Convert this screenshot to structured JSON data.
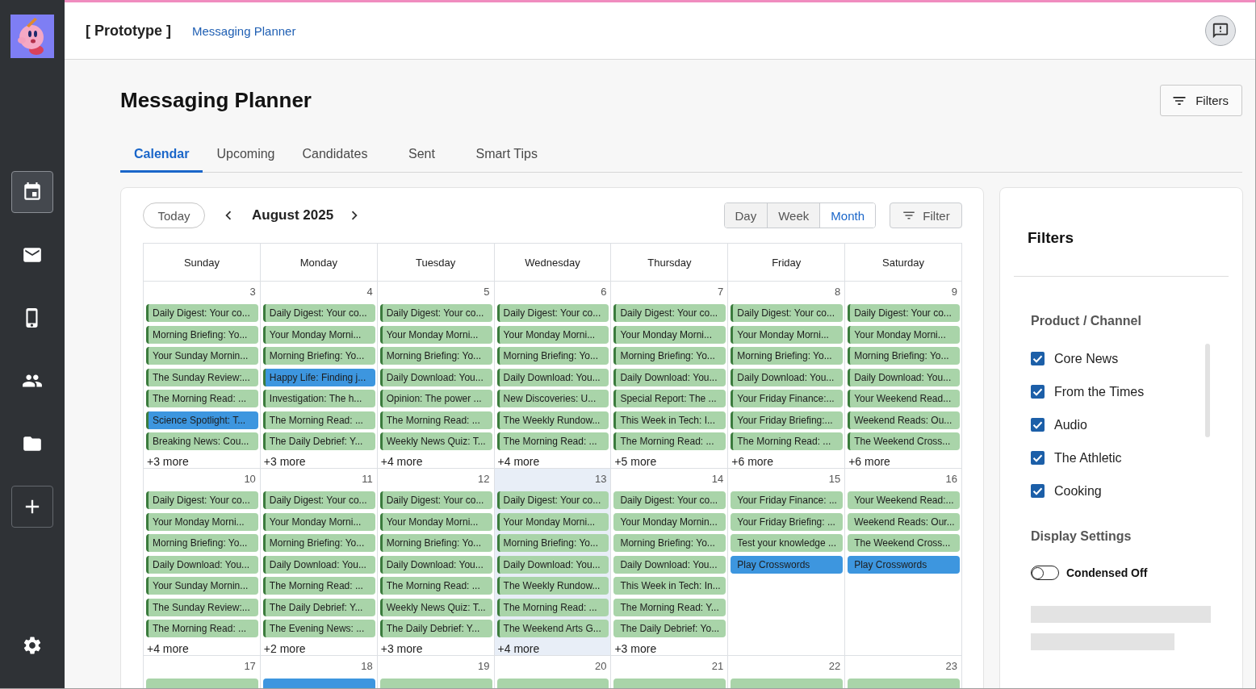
{
  "sidebar": {
    "nav": [
      {
        "selected": true
      },
      {
        "selected": false
      },
      {
        "selected": false
      },
      {
        "selected": false
      },
      {
        "selected": false
      }
    ]
  },
  "header": {
    "brand": "[ Prototype ]",
    "breadcrumb": "Messaging Planner"
  },
  "page": {
    "title": "Messaging Planner",
    "filters_button": "Filters"
  },
  "tabs": [
    {
      "label": "Calendar",
      "selected": true
    },
    {
      "label": "Upcoming",
      "selected": false
    },
    {
      "label": "Candidates",
      "selected": false
    },
    {
      "label": "Sent",
      "selected": false
    },
    {
      "label": "Smart Tips",
      "selected": false
    }
  ],
  "calendar": {
    "today_button": "Today",
    "month": "August 2025",
    "views": [
      {
        "label": "Day",
        "selected": false
      },
      {
        "label": "Week",
        "selected": false
      },
      {
        "label": "Month",
        "selected": true
      }
    ],
    "filter_button": "Filter",
    "weekdays": [
      "Sunday",
      "Monday",
      "Tuesday",
      "Wednesday",
      "Thursday",
      "Friday",
      "Saturday"
    ],
    "weeks": [
      {
        "days": [
          {
            "date": "3",
            "today": false,
            "sent": true,
            "events": [
              {
                "title": "Daily Digest: Your co...",
                "color": "#a9d4a9"
              },
              {
                "title": "Morning Briefing: Yo...",
                "color": "#a9d4a9"
              },
              {
                "title": "Your Sunday Mornin...",
                "color": "#a9d4a9"
              },
              {
                "title": "The Sunday Review:...",
                "color": "#a9d4a9"
              },
              {
                "title": "The Morning Read: ...",
                "color": "#a9d4a9"
              },
              {
                "title": "Science Spotlight: T...",
                "color": "#3d96df"
              },
              {
                "title": "Breaking News: Cou...",
                "color": "#a9d4a9"
              }
            ],
            "more": "+3 more"
          },
          {
            "date": "4",
            "today": false,
            "sent": true,
            "events": [
              {
                "title": "Daily Digest: Your co...",
                "color": "#a9d4a9"
              },
              {
                "title": "Your Monday Morni...",
                "color": "#a9d4a9"
              },
              {
                "title": "Morning Briefing: Yo...",
                "color": "#a9d4a9"
              },
              {
                "title": "Happy Life: Finding j...",
                "color": "#3d96df"
              },
              {
                "title": "Investigation: The h...",
                "color": "#a9d4a9"
              },
              {
                "title": "The Morning Read: ...",
                "color": "#a9d4a9"
              },
              {
                "title": "The Daily Debrief: Y...",
                "color": "#a9d4a9"
              }
            ],
            "more": "+3 more"
          },
          {
            "date": "5",
            "today": false,
            "sent": true,
            "events": [
              {
                "title": "Daily Digest: Your co...",
                "color": "#a9d4a9"
              },
              {
                "title": "Your Monday Morni...",
                "color": "#a9d4a9"
              },
              {
                "title": "Morning Briefing: Yo...",
                "color": "#a9d4a9"
              },
              {
                "title": "Daily Download: You...",
                "color": "#a9d4a9"
              },
              {
                "title": "Opinion: The power ...",
                "color": "#a9d4a9"
              },
              {
                "title": "The Morning Read: ...",
                "color": "#a9d4a9"
              },
              {
                "title": "Weekly News Quiz: T...",
                "color": "#a9d4a9"
              }
            ],
            "more": "+4 more"
          },
          {
            "date": "6",
            "today": false,
            "sent": true,
            "events": [
              {
                "title": "Daily Digest: Your co...",
                "color": "#a9d4a9"
              },
              {
                "title": "Your Monday Morni...",
                "color": "#a9d4a9"
              },
              {
                "title": "Morning Briefing: Yo...",
                "color": "#a9d4a9"
              },
              {
                "title": "Daily Download: You...",
                "color": "#a9d4a9"
              },
              {
                "title": "New Discoveries: U...",
                "color": "#a9d4a9"
              },
              {
                "title": "The Weekly Rundow...",
                "color": "#a9d4a9"
              },
              {
                "title": "The Morning Read: ...",
                "color": "#a9d4a9"
              }
            ],
            "more": "+4 more"
          },
          {
            "date": "7",
            "today": false,
            "sent": true,
            "events": [
              {
                "title": "Daily Digest: Your co...",
                "color": "#a9d4a9"
              },
              {
                "title": "Your Monday Morni...",
                "color": "#a9d4a9"
              },
              {
                "title": "Morning Briefing: Yo...",
                "color": "#a9d4a9"
              },
              {
                "title": "Daily Download: You...",
                "color": "#a9d4a9"
              },
              {
                "title": "Special Report: The ...",
                "color": "#a9d4a9"
              },
              {
                "title": "This Week in Tech: I...",
                "color": "#a9d4a9"
              },
              {
                "title": "The Morning Read: ...",
                "color": "#a9d4a9"
              }
            ],
            "more": "+5 more"
          },
          {
            "date": "8",
            "today": false,
            "sent": true,
            "events": [
              {
                "title": "Daily Digest: Your co...",
                "color": "#a9d4a9"
              },
              {
                "title": "Your Monday Morni...",
                "color": "#a9d4a9"
              },
              {
                "title": "Morning Briefing: Yo...",
                "color": "#a9d4a9"
              },
              {
                "title": "Daily Download: You...",
                "color": "#a9d4a9"
              },
              {
                "title": "Your Friday Finance:...",
                "color": "#a9d4a9"
              },
              {
                "title": "Your Friday Briefing:...",
                "color": "#a9d4a9"
              },
              {
                "title": "The Morning Read: ...",
                "color": "#a9d4a9"
              }
            ],
            "more": "+6 more"
          },
          {
            "date": "9",
            "today": false,
            "sent": true,
            "events": [
              {
                "title": "Daily Digest: Your co...",
                "color": "#a9d4a9"
              },
              {
                "title": "Your Monday Morni...",
                "color": "#a9d4a9"
              },
              {
                "title": "Morning Briefing: Yo...",
                "color": "#a9d4a9"
              },
              {
                "title": "Daily Download: You...",
                "color": "#a9d4a9"
              },
              {
                "title": "Your Weekend Read...",
                "color": "#a9d4a9"
              },
              {
                "title": "Weekend Reads: Ou...",
                "color": "#a9d4a9"
              },
              {
                "title": "The Weekend Cross...",
                "color": "#a9d4a9"
              }
            ],
            "more": "+6 more"
          }
        ]
      },
      {
        "days": [
          {
            "date": "10",
            "today": false,
            "sent": true,
            "events": [
              {
                "title": "Daily Digest: Your co...",
                "color": "#a9d4a9"
              },
              {
                "title": "Your Monday Morni...",
                "color": "#a9d4a9"
              },
              {
                "title": "Morning Briefing: Yo...",
                "color": "#a9d4a9"
              },
              {
                "title": "Daily Download: You...",
                "color": "#a9d4a9"
              },
              {
                "title": "Your Sunday Mornin...",
                "color": "#a9d4a9"
              },
              {
                "title": "The Sunday Review:...",
                "color": "#a9d4a9"
              },
              {
                "title": "The Morning Read: ...",
                "color": "#a9d4a9"
              }
            ],
            "more": "+4 more"
          },
          {
            "date": "11",
            "today": false,
            "sent": true,
            "events": [
              {
                "title": "Daily Digest: Your co...",
                "color": "#a9d4a9"
              },
              {
                "title": "Your Monday Morni...",
                "color": "#a9d4a9"
              },
              {
                "title": "Morning Briefing: Yo...",
                "color": "#a9d4a9"
              },
              {
                "title": "Daily Download: You...",
                "color": "#a9d4a9"
              },
              {
                "title": "The Morning Read: ...",
                "color": "#a9d4a9"
              },
              {
                "title": "The Daily Debrief: Y...",
                "color": "#a9d4a9"
              },
              {
                "title": "The Evening News: ...",
                "color": "#a9d4a9"
              }
            ],
            "more": "+2 more"
          },
          {
            "date": "12",
            "today": false,
            "sent": true,
            "events": [
              {
                "title": "Daily Digest: Your co...",
                "color": "#a9d4a9"
              },
              {
                "title": "Your Monday Morni...",
                "color": "#a9d4a9"
              },
              {
                "title": "Morning Briefing: Yo...",
                "color": "#a9d4a9"
              },
              {
                "title": "Daily Download: You...",
                "color": "#a9d4a9"
              },
              {
                "title": "The Morning Read: ...",
                "color": "#a9d4a9"
              },
              {
                "title": "Weekly News Quiz: T...",
                "color": "#a9d4a9"
              },
              {
                "title": "The Daily Debrief: Y...",
                "color": "#a9d4a9"
              }
            ],
            "more": "+3 more"
          },
          {
            "date": "13",
            "today": true,
            "sent": true,
            "events": [
              {
                "title": "Daily Digest: Your co...",
                "color": "#a9d4a9"
              },
              {
                "title": "Your Monday Morni...",
                "color": "#a9d4a9"
              },
              {
                "title": "Morning Briefing: Yo...",
                "color": "#a9d4a9"
              },
              {
                "title": "Daily Download: You...",
                "color": "#a9d4a9"
              },
              {
                "title": "The Weekly Rundow...",
                "color": "#a9d4a9"
              },
              {
                "title": "The Morning Read: ...",
                "color": "#a9d4a9"
              },
              {
                "title": "The Weekend Arts G...",
                "color": "#a9d4a9"
              }
            ],
            "more": "+4 more"
          },
          {
            "date": "14",
            "today": false,
            "sent": false,
            "events": [
              {
                "title": "Daily Digest: Your co...",
                "color": "#a9d4a9"
              },
              {
                "title": "Your Monday Mornin...",
                "color": "#a9d4a9"
              },
              {
                "title": "Morning Briefing: Yo...",
                "color": "#a9d4a9"
              },
              {
                "title": "Daily Download: You...",
                "color": "#a9d4a9"
              },
              {
                "title": "This Week in Tech: In...",
                "color": "#a9d4a9"
              },
              {
                "title": "The Morning Read: Y...",
                "color": "#a9d4a9"
              },
              {
                "title": "The Daily Debrief: Yo...",
                "color": "#a9d4a9"
              }
            ],
            "more": "+3 more"
          },
          {
            "date": "15",
            "today": false,
            "sent": false,
            "events": [
              {
                "title": "Your Friday Finance: ...",
                "color": "#a9d4a9"
              },
              {
                "title": "Your Friday Briefing: ...",
                "color": "#a9d4a9"
              },
              {
                "title": "Test your knowledge ...",
                "color": "#a9d4a9"
              },
              {
                "title": "Play Crosswords",
                "color": "#3d96df"
              }
            ]
          },
          {
            "date": "16",
            "today": false,
            "sent": false,
            "events": [
              {
                "title": "Your Weekend Read:...",
                "color": "#a9d4a9"
              },
              {
                "title": "Weekend Reads: Our...",
                "color": "#a9d4a9"
              },
              {
                "title": "The Weekend Cross...",
                "color": "#a9d4a9"
              },
              {
                "title": "Play Crosswords",
                "color": "#3d96df"
              }
            ]
          }
        ]
      },
      {
        "days": [
          {
            "date": "17",
            "today": false,
            "sent": false,
            "events": [
              {
                "color": "#a9d4a9"
              }
            ]
          },
          {
            "date": "18",
            "today": false,
            "sent": false,
            "events": [
              {
                "color": "#3d96df"
              }
            ]
          },
          {
            "date": "19",
            "today": false,
            "sent": false,
            "events": [
              {
                "color": "#a9d4a9"
              }
            ]
          },
          {
            "date": "20",
            "today": false,
            "sent": false,
            "events": [
              {
                "color": "#a9d4a9"
              }
            ]
          },
          {
            "date": "21",
            "today": false,
            "sent": false,
            "events": [
              {
                "color": "#a9d4a9"
              }
            ]
          },
          {
            "date": "22",
            "today": false,
            "sent": false,
            "events": [
              {
                "color": "#a9d4a9"
              }
            ]
          },
          {
            "date": "23",
            "today": false,
            "sent": false,
            "events": [
              {
                "color": "#a9d4a9"
              }
            ]
          }
        ]
      }
    ]
  },
  "filters_panel": {
    "title": "Filters",
    "product_channel": {
      "heading": "Product / Channel",
      "options": [
        {
          "label": "Core News",
          "checked": true
        },
        {
          "label": "From the Times",
          "checked": true
        },
        {
          "label": "Audio",
          "checked": true
        },
        {
          "label": "The Athletic",
          "checked": true
        },
        {
          "label": "Cooking",
          "checked": true
        }
      ]
    },
    "display_settings": {
      "heading": "Display Settings",
      "toggle": {
        "label": "Condensed Off",
        "on": false
      }
    }
  }
}
